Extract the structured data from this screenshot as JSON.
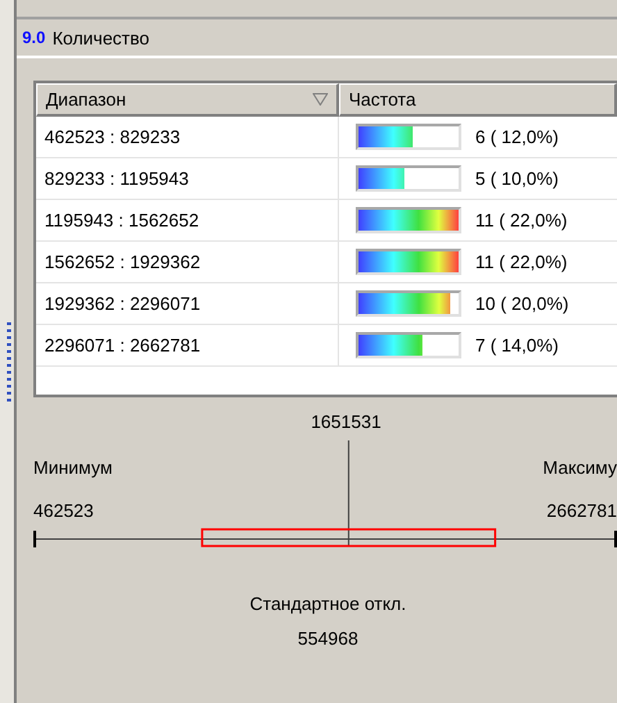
{
  "panel": {
    "number": "9.0",
    "title": "Количество"
  },
  "table": {
    "columns": [
      {
        "label": "Диапазон",
        "sort_icon": true
      },
      {
        "label": "Частота",
        "sort_icon": false
      }
    ],
    "rows": [
      {
        "range": "462523 : 829233",
        "level": 0.545,
        "count": "6 ( 12,0%)"
      },
      {
        "range": "829233 : 1195943",
        "level": 0.455,
        "count": "5 ( 10,0%)"
      },
      {
        "range": "1195943 : 1562652",
        "level": 1,
        "count": "11 ( 22,0%)"
      },
      {
        "range": "1562652 : 1929362",
        "level": 1,
        "count": "11 ( 22,0%)"
      },
      {
        "range": "1929362 : 2296071",
        "level": 0.91,
        "count": "10 ( 20,0%)"
      },
      {
        "range": "2296071 : 2662781",
        "level": 0.636,
        "count": "7 ( 14,0%)"
      }
    ]
  },
  "stats": {
    "median": "1651531",
    "min_label": "Минимум",
    "min": "462523",
    "max_label": "Максиму",
    "max": "2662781",
    "std_label": "Стандартное откл.",
    "std": "554968"
  }
}
